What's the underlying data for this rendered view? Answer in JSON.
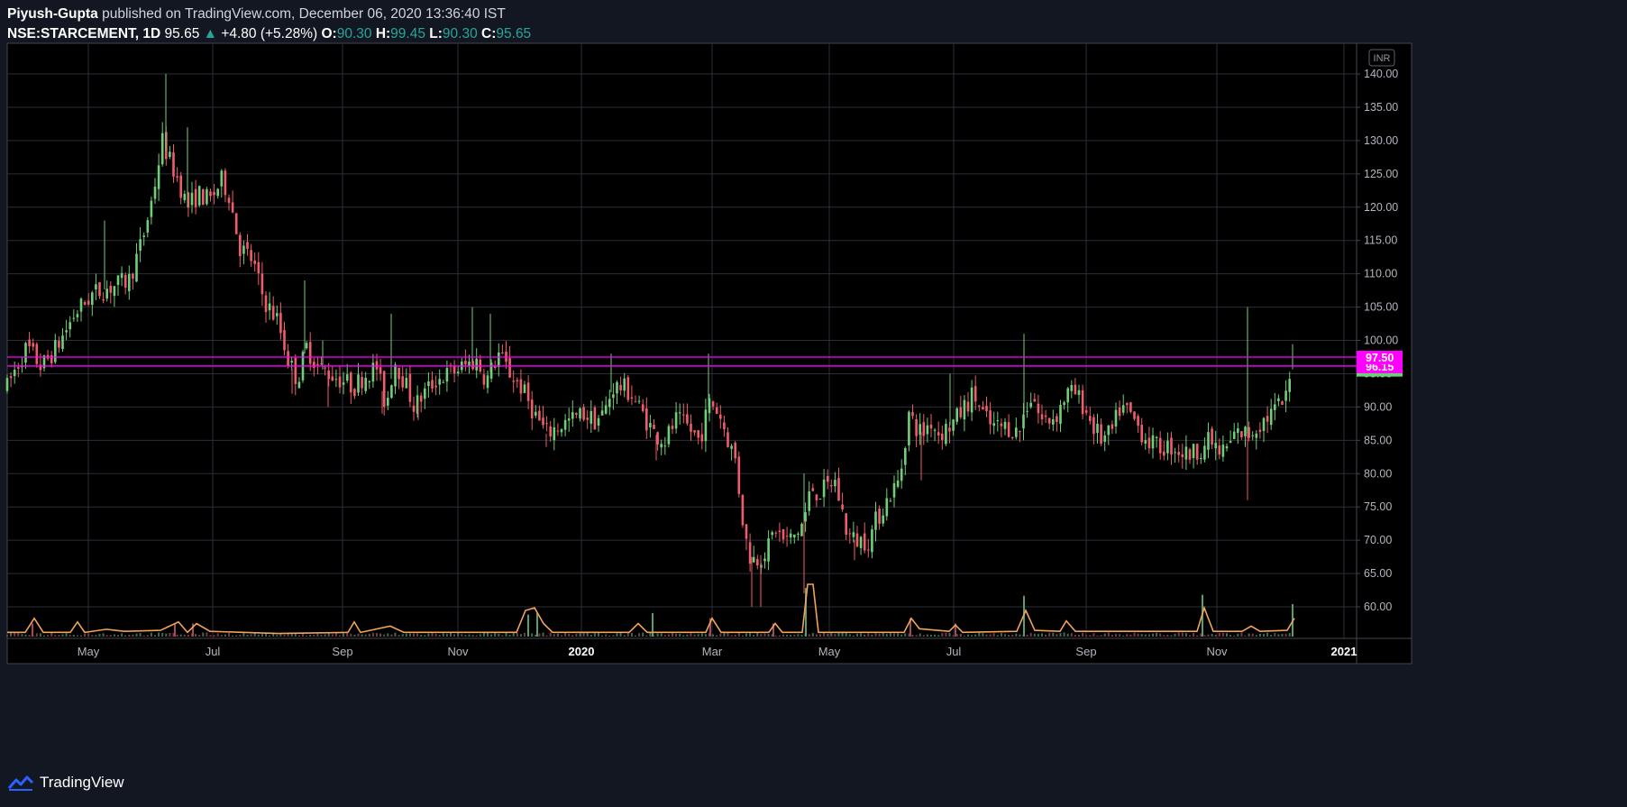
{
  "header": {
    "author": "Piyush-Gupta",
    "published_text": "published on TradingView.com, December 06, 2020 13:36:40 IST",
    "symbol": "NSE:STARCEMENT, 1D",
    "last": "95.65",
    "change": "+4.80 (+5.28%)",
    "o_label": "O:",
    "o_value": "90.30",
    "h_label": "H:",
    "h_value": "99.45",
    "l_label": "L:",
    "l_value": "90.30",
    "c_label": "C:",
    "c_value": "95.65"
  },
  "footer": {
    "brand": "TradingView",
    "icon": "tradingview-logo-icon"
  },
  "colors": {
    "background": "#131722",
    "plot": "#000000",
    "grid": "#2a2e39",
    "axis_text": "#b2b5be",
    "up": "#6fcf77",
    "down": "#ef5d6b",
    "volume_ma": "#f0a35c",
    "level": "#ff00ff"
  },
  "chart_data": {
    "type": "candlestick",
    "currency_badge": "INR",
    "y_ticks": [
      "60.00",
      "65.00",
      "70.00",
      "75.00",
      "80.00",
      "85.00",
      "90.00",
      "95.00",
      "100.00",
      "105.00",
      "110.00",
      "115.00",
      "120.00",
      "125.00",
      "130.00",
      "135.00",
      "140.00"
    ],
    "ylim": [
      56,
      145
    ],
    "x_ticks": [
      "May",
      "Jul",
      "Sep",
      "Nov",
      "2020",
      "Mar",
      "May",
      "Jul",
      "Sep",
      "Nov",
      "2021"
    ],
    "x_tick_bold": [
      false,
      false,
      false,
      false,
      true,
      false,
      false,
      false,
      false,
      false,
      true
    ],
    "price_levels": [
      {
        "label": "97.50",
        "value": 97.5
      },
      {
        "label": "96.15",
        "value": 96.15
      }
    ],
    "last_price": 95.65,
    "price_path": [
      [
        0,
        93
      ],
      [
        10,
        96
      ],
      [
        22,
        99
      ],
      [
        38,
        96
      ],
      [
        55,
        99
      ],
      [
        75,
        104
      ],
      [
        95,
        107
      ],
      [
        115,
        108
      ],
      [
        135,
        109
      ],
      [
        150,
        115
      ],
      [
        162,
        122
      ],
      [
        172,
        130
      ],
      [
        180,
        127
      ],
      [
        190,
        124
      ],
      [
        200,
        120
      ],
      [
        212,
        122
      ],
      [
        225,
        121
      ],
      [
        238,
        124
      ],
      [
        246,
        122
      ],
      [
        258,
        114
      ],
      [
        272,
        112
      ],
      [
        285,
        106
      ],
      [
        300,
        103
      ],
      [
        312,
        97
      ],
      [
        322,
        94
      ],
      [
        332,
        99
      ],
      [
        345,
        96
      ],
      [
        358,
        95
      ],
      [
        372,
        94
      ],
      [
        385,
        93
      ],
      [
        398,
        95
      ],
      [
        410,
        96
      ],
      [
        420,
        90
      ],
      [
        430,
        97
      ],
      [
        440,
        94
      ],
      [
        452,
        90
      ],
      [
        462,
        92
      ],
      [
        475,
        94
      ],
      [
        490,
        95
      ],
      [
        505,
        96
      ],
      [
        520,
        97
      ],
      [
        532,
        94
      ],
      [
        545,
        98
      ],
      [
        558,
        95
      ],
      [
        570,
        93
      ],
      [
        585,
        89
      ],
      [
        598,
        86
      ],
      [
        610,
        87
      ],
      [
        625,
        88
      ],
      [
        640,
        89
      ],
      [
        652,
        88
      ],
      [
        662,
        89
      ],
      [
        672,
        93
      ],
      [
        682,
        93
      ],
      [
        692,
        92
      ],
      [
        705,
        89
      ],
      [
        718,
        86
      ],
      [
        730,
        85
      ],
      [
        742,
        88
      ],
      [
        755,
        87
      ],
      [
        768,
        85
      ],
      [
        780,
        91
      ],
      [
        790,
        89
      ],
      [
        800,
        85
      ],
      [
        808,
        82
      ],
      [
        815,
        74
      ],
      [
        822,
        68
      ],
      [
        830,
        67
      ],
      [
        838,
        68
      ],
      [
        845,
        69
      ],
      [
        852,
        72
      ],
      [
        860,
        70
      ],
      [
        868,
        70
      ],
      [
        876,
        71
      ],
      [
        884,
        73
      ],
      [
        892,
        78
      ],
      [
        900,
        77
      ],
      [
        910,
        78
      ],
      [
        918,
        79
      ],
      [
        925,
        75
      ],
      [
        932,
        71
      ],
      [
        940,
        70
      ],
      [
        948,
        70
      ],
      [
        956,
        70
      ],
      [
        964,
        73
      ],
      [
        972,
        75
      ],
      [
        980,
        77
      ],
      [
        990,
        79
      ],
      [
        1000,
        89
      ],
      [
        1008,
        87
      ],
      [
        1016,
        86
      ],
      [
        1024,
        88
      ],
      [
        1034,
        86
      ],
      [
        1044,
        87
      ],
      [
        1052,
        88
      ],
      [
        1062,
        90
      ],
      [
        1072,
        92
      ],
      [
        1082,
        89
      ],
      [
        1092,
        87
      ],
      [
        1102,
        87
      ],
      [
        1112,
        87
      ],
      [
        1122,
        86
      ],
      [
        1130,
        90
      ],
      [
        1138,
        92
      ],
      [
        1146,
        88
      ],
      [
        1155,
        88
      ],
      [
        1165,
        89
      ],
      [
        1175,
        92
      ],
      [
        1185,
        92
      ],
      [
        1195,
        90
      ],
      [
        1205,
        87
      ],
      [
        1215,
        85
      ],
      [
        1225,
        86
      ],
      [
        1235,
        90
      ],
      [
        1245,
        89
      ],
      [
        1255,
        87
      ],
      [
        1265,
        85
      ],
      [
        1275,
        84
      ],
      [
        1285,
        84
      ],
      [
        1295,
        84
      ],
      [
        1305,
        83
      ],
      [
        1315,
        83
      ],
      [
        1325,
        84
      ],
      [
        1335,
        85
      ],
      [
        1345,
        83
      ],
      [
        1355,
        84
      ],
      [
        1362,
        86
      ],
      [
        1370,
        86
      ],
      [
        1378,
        86
      ],
      [
        1386,
        87
      ],
      [
        1394,
        88
      ],
      [
        1402,
        89
      ],
      [
        1410,
        90
      ],
      [
        1418,
        91
      ],
      [
        1426,
        95.65
      ]
    ],
    "spikes": [
      [
        176,
        140
      ],
      [
        200,
        132
      ],
      [
        108,
        118
      ],
      [
        330,
        109
      ],
      [
        350,
        100
      ],
      [
        426,
        104
      ],
      [
        516,
        105
      ],
      [
        536,
        104
      ],
      [
        670,
        98
      ],
      [
        778,
        98
      ],
      [
        884,
        80
      ],
      [
        1046,
        95
      ],
      [
        1128,
        101
      ],
      [
        1376,
        105
      ],
      [
        1426,
        99.45
      ]
    ],
    "dips": [
      [
        316,
        92
      ],
      [
        356,
        90
      ],
      [
        416,
        89
      ],
      [
        456,
        88
      ],
      [
        598,
        84
      ],
      [
        720,
        82
      ],
      [
        826,
        60
      ],
      [
        836,
        60
      ],
      [
        884,
        62
      ],
      [
        940,
        67
      ],
      [
        1014,
        79
      ],
      [
        1376,
        76
      ]
    ],
    "volume_spikes": [
      [
        28,
        0.25
      ],
      [
        578,
        0.42
      ],
      [
        588,
        0.45
      ],
      [
        716,
        0.45
      ],
      [
        780,
        0.35
      ],
      [
        886,
        0.93
      ],
      [
        1002,
        0.35
      ],
      [
        1128,
        0.78
      ],
      [
        1326,
        0.8
      ],
      [
        1426,
        0.62
      ],
      [
        850,
        0.25
      ],
      [
        1052,
        0.25
      ],
      [
        186,
        0.25
      ],
      [
        206,
        0.25
      ]
    ],
    "volume_ma": [
      [
        0,
        0.08
      ],
      [
        20,
        0.08
      ],
      [
        30,
        0.35
      ],
      [
        40,
        0.08
      ],
      [
        70,
        0.08
      ],
      [
        78,
        0.28
      ],
      [
        86,
        0.08
      ],
      [
        110,
        0.14
      ],
      [
        130,
        0.1
      ],
      [
        170,
        0.12
      ],
      [
        190,
        0.28
      ],
      [
        200,
        0.08
      ],
      [
        210,
        0.25
      ],
      [
        225,
        0.1
      ],
      [
        300,
        0.06
      ],
      [
        378,
        0.08
      ],
      [
        385,
        0.28
      ],
      [
        392,
        0.08
      ],
      [
        425,
        0.2
      ],
      [
        440,
        0.08
      ],
      [
        565,
        0.08
      ],
      [
        575,
        0.5
      ],
      [
        585,
        0.55
      ],
      [
        595,
        0.25
      ],
      [
        605,
        0.08
      ],
      [
        690,
        0.08
      ],
      [
        700,
        0.25
      ],
      [
        710,
        0.08
      ],
      [
        775,
        0.08
      ],
      [
        782,
        0.35
      ],
      [
        792,
        0.08
      ],
      [
        845,
        0.08
      ],
      [
        852,
        0.25
      ],
      [
        860,
        0.08
      ],
      [
        882,
        0.08
      ],
      [
        888,
        1.0
      ],
      [
        894,
        1.0
      ],
      [
        900,
        0.08
      ],
      [
        995,
        0.08
      ],
      [
        1003,
        0.35
      ],
      [
        1012,
        0.15
      ],
      [
        1045,
        0.1
      ],
      [
        1052,
        0.22
      ],
      [
        1060,
        0.08
      ],
      [
        1120,
        0.1
      ],
      [
        1130,
        0.5
      ],
      [
        1140,
        0.12
      ],
      [
        1168,
        0.1
      ],
      [
        1175,
        0.3
      ],
      [
        1185,
        0.1
      ],
      [
        1320,
        0.1
      ],
      [
        1328,
        0.55
      ],
      [
        1338,
        0.1
      ],
      [
        1370,
        0.1
      ],
      [
        1380,
        0.2
      ],
      [
        1390,
        0.1
      ],
      [
        1420,
        0.12
      ],
      [
        1428,
        0.35
      ]
    ]
  }
}
